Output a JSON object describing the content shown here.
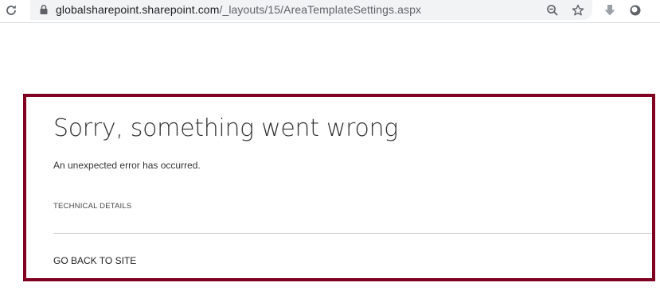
{
  "browser": {
    "url_host": "globalsharepoint.sharepoint.com",
    "url_path": "/_layouts/15/AreaTemplateSettings.aspx",
    "icons": {
      "reload": "reload-icon",
      "lock": "lock-icon",
      "zoom": "zoom-out-icon",
      "bookmark": "star-icon",
      "download_ext": "download-arrow-icon",
      "profile_ext": "extension-circle-icon"
    }
  },
  "error": {
    "title": "Sorry, something went wrong",
    "message": "An unexpected error has occurred.",
    "technical_details": "TECHNICAL DETAILS",
    "go_back": "GO BACK TO SITE"
  },
  "colors": {
    "panel_border": "#800020",
    "omnibox_bg": "#f1f3f4",
    "text": "#333333"
  }
}
